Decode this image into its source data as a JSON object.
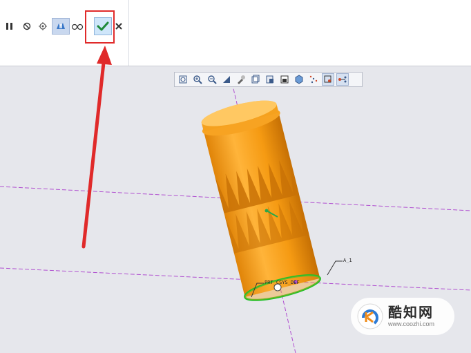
{
  "ribbon": {
    "buttons": [
      {
        "id": "pause",
        "icon": "pause-icon"
      },
      {
        "id": "stop",
        "icon": "no-entry-icon"
      },
      {
        "id": "glasses1",
        "icon": "glasses-gear-icon"
      },
      {
        "id": "preview",
        "icon": "preview-icon"
      },
      {
        "id": "glasses2",
        "icon": "glasses-icon"
      },
      {
        "id": "ok",
        "icon": "checkmark-icon"
      },
      {
        "id": "cancel",
        "icon": "close-icon"
      }
    ]
  },
  "graphics_toolbar": {
    "icons": [
      "refit-icon",
      "zoom-in-icon",
      "zoom-out-icon",
      "repaint-icon",
      "view-manager-icon",
      "saved-orientations-icon",
      "display-style-icon",
      "section-icon",
      "appearance-icon",
      "datum-display-icon",
      "spin-center-icon",
      "annotation-display-icon"
    ]
  },
  "model": {
    "body_color": "#f29a14",
    "axis_label_1": "A_1",
    "axis_label_2": "PRT_CSYS_DEF"
  },
  "watermark": {
    "title": "酷知网",
    "url": "www.coozhi.com"
  },
  "colors": {
    "accent_red": "#e02a2a",
    "datum_purple": "#b04fd0",
    "selection_green": "#22c02a"
  }
}
